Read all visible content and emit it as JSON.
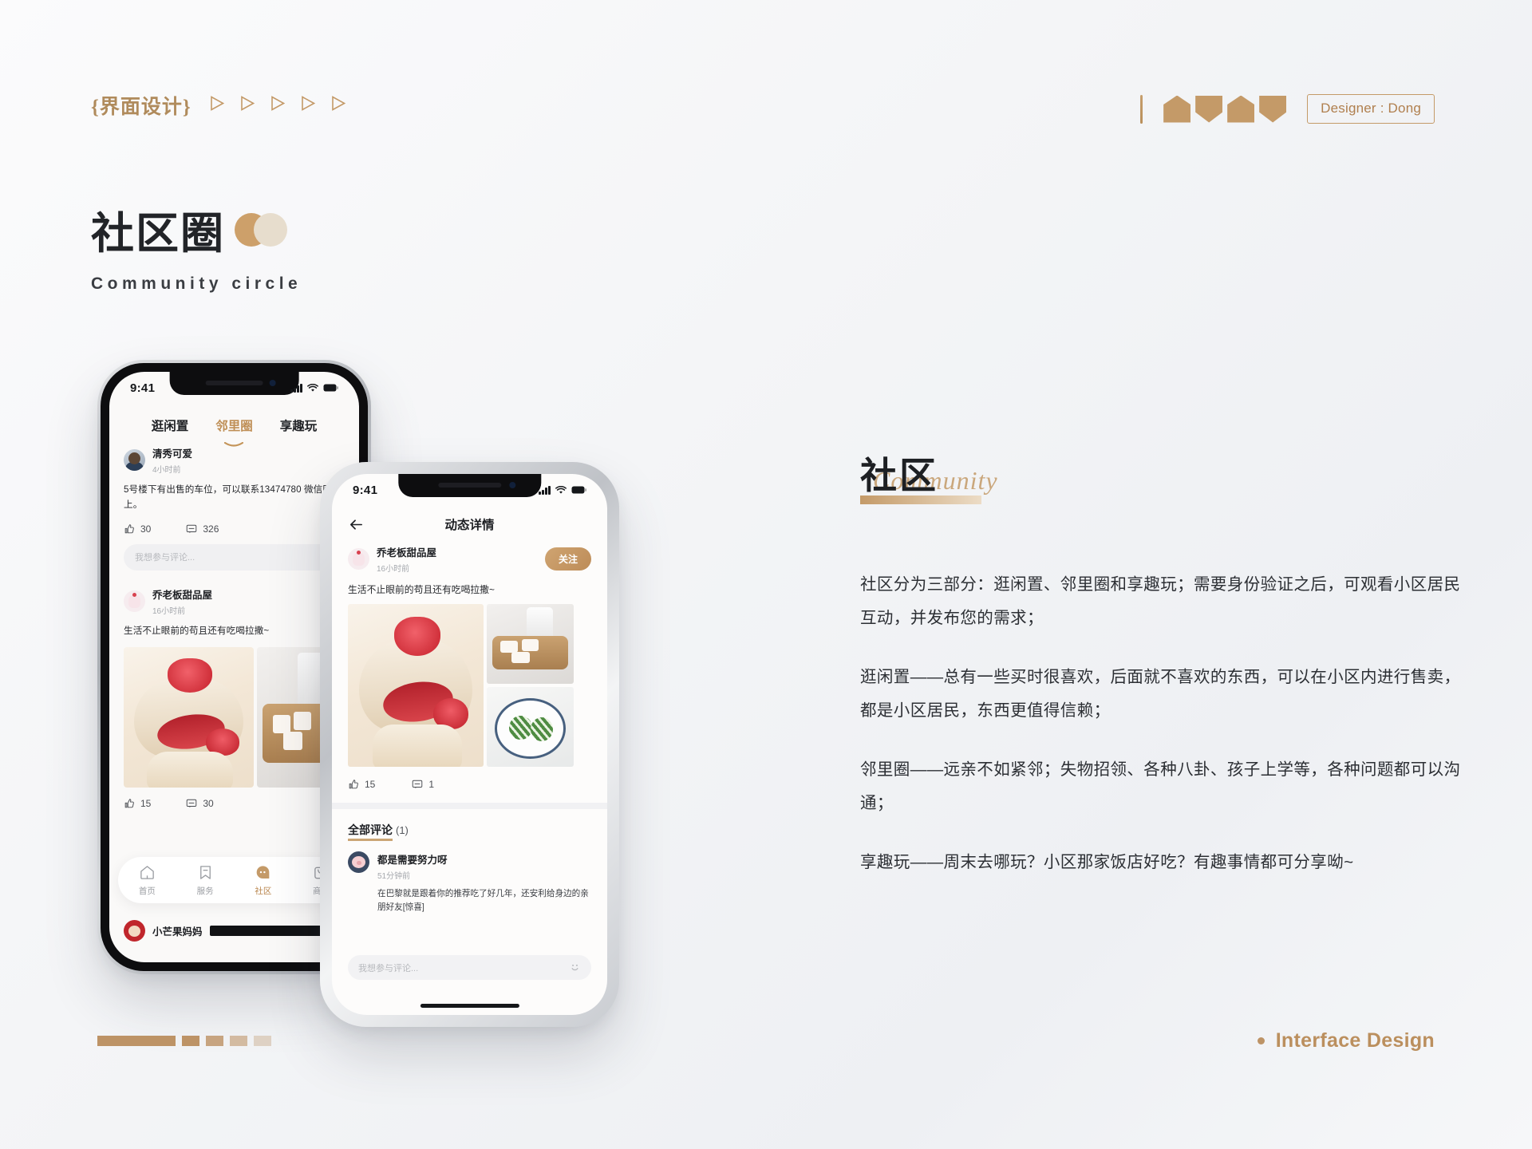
{
  "header": {
    "brand_tag": "{界面设计}",
    "arrow_count": 5,
    "designer_badge": "Designer : Dong",
    "accent_color": "#c49a68"
  },
  "title_block": {
    "cn_title": "社区圈",
    "en_title": "Community circle"
  },
  "phone1": {
    "status": {
      "time": "9:41"
    },
    "tabs": [
      {
        "label": "逛闲置",
        "active": false
      },
      {
        "label": "邻里圈",
        "active": true
      },
      {
        "label": "享趣玩",
        "active": false
      }
    ],
    "posts": [
      {
        "user": "清秀可爱",
        "time": "4小时前",
        "text": "5号楼下有出售的车位，可以联系13474780 微信同上。",
        "likes": "30",
        "comments": "326",
        "comment_placeholder": "我想参与评论..."
      },
      {
        "user": "乔老板甜品屋",
        "time": "16小时前",
        "text": "生活不止眼前的苟且还有吃喝拉撒~",
        "likes": "15",
        "comments": "30"
      }
    ],
    "nav": [
      {
        "label": "首页",
        "icon": "home-icon",
        "active": false
      },
      {
        "label": "服务",
        "icon": "bookmark-icon",
        "active": false
      },
      {
        "label": "社区",
        "icon": "community-icon",
        "active": true
      },
      {
        "label": "商城",
        "icon": "bag-icon",
        "active": false
      }
    ],
    "partial_post_user": "小芒果妈妈"
  },
  "phone2": {
    "status": {
      "time": "9:41"
    },
    "nav_title": "动态详情",
    "post": {
      "user": "乔老板甜品屋",
      "time": "16小时前",
      "follow_label": "关注",
      "text": "生活不止眼前的苟且还有吃喝拉撒~",
      "likes": "15",
      "comments": "1"
    },
    "comments_header": {
      "label": "全部评论",
      "count": "(1)"
    },
    "comments": [
      {
        "user": "都是需要努力呀",
        "time": "51分钟前",
        "text": "在巴黎就是跟着你的推荐吃了好几年，还安利给身边的亲朋好友[惊喜]"
      }
    ],
    "input_placeholder": "我想参与评论..."
  },
  "right_panel": {
    "title": "社区",
    "script_watermark": "Community",
    "paragraphs": [
      "社区分为三部分：逛闲置、邻里圈和享趣玩；需要身份验证之后，可观看小区居民互动，并发布您的需求；",
      "逛闲置——总有一些买时很喜欢，后面就不喜欢的东西，可以在小区内进行售卖，都是小区居民，东西更值得信赖；",
      "邻里圈——远亲不如紧邻；失物招领、各种八卦、孩子上学等，各种问题都可以沟通；",
      "享趣玩——周末去哪玩？小区那家饭店好吃？有趣事情都可分享呦~"
    ]
  },
  "footer": {
    "progress_segments": 5,
    "right_label": "Interface Design"
  }
}
